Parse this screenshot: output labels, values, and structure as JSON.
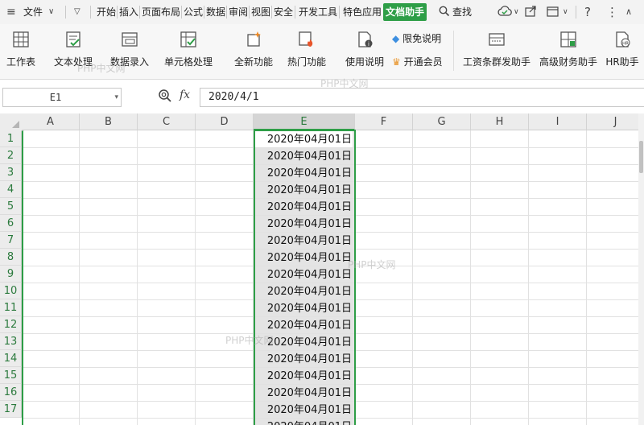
{
  "menubar": {
    "file_label": "文件",
    "tabs": [
      "开始",
      "插入",
      "页面布局",
      "公式",
      "数据",
      "审阅",
      "视图",
      "安全",
      "开发工具",
      "特色应用",
      "文档助手"
    ],
    "search_label": "查找"
  },
  "ribbon": {
    "buttons": [
      {
        "label": "工作表"
      },
      {
        "label": "文本处理"
      },
      {
        "label": "数据录入"
      },
      {
        "label": "单元格处理"
      },
      {
        "label": "全新功能"
      },
      {
        "label": "热门功能"
      },
      {
        "label": "使用说明"
      },
      {
        "label": "工资条群发助手"
      },
      {
        "label": "高级财务助手"
      },
      {
        "label": "HR助手"
      }
    ],
    "limited_free_label": "限免说明",
    "vip_label": "开通会员"
  },
  "formula_bar": {
    "name_box": "E1",
    "fx_label": "fx",
    "formula": "2020/4/1"
  },
  "grid": {
    "columns": [
      "A",
      "B",
      "C",
      "D",
      "E",
      "F",
      "G",
      "H",
      "I",
      "J"
    ],
    "selected_column": "E",
    "rows": [
      "1",
      "2",
      "3",
      "4",
      "5",
      "6",
      "7",
      "8",
      "9",
      "10",
      "11",
      "12",
      "13",
      "14",
      "15",
      "16",
      "17"
    ],
    "cell_value": "2020年04月01日"
  },
  "watermarks": [
    "PHP中文网",
    "PHP中文网",
    "PHP中文网",
    "PHP中文网"
  ],
  "colors": {
    "accent": "#2e9e47",
    "selection_fill": "#e4e4e4"
  }
}
